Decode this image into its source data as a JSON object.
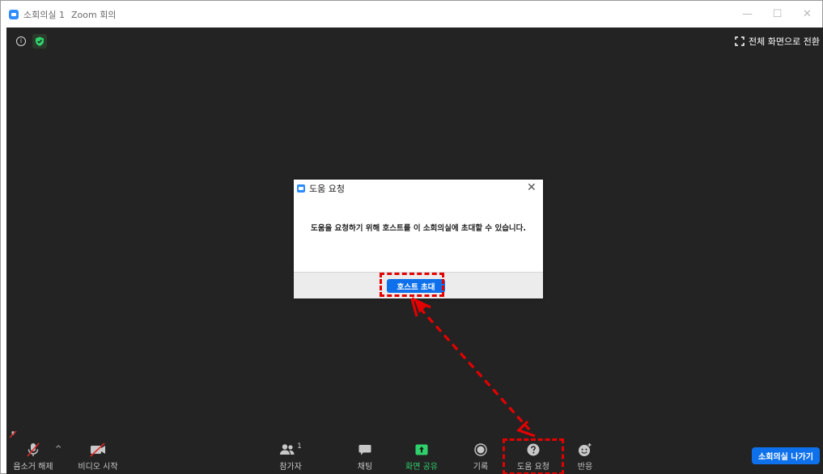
{
  "window": {
    "title": "소회의실 1",
    "subtitle": "Zoom 회의",
    "controls": {
      "minimize": "—",
      "maximize": "☐",
      "close": "✕"
    }
  },
  "meeting": {
    "info_icon": "i",
    "fullscreen_label": "전체 화면으로 전환"
  },
  "dialog": {
    "title": "도움 요청",
    "close": "✕",
    "message": "도움을 요청하기 위해 호스트를 이 소회의실에 초대할 수 있습니다.",
    "invite_button": "호스트 초대"
  },
  "toolbar": {
    "unmute": "음소거 해제",
    "start_video": "비디오 시작",
    "participants": "참가자",
    "participant_count": "1",
    "chat": "채팅",
    "share_screen": "화면 공유",
    "record": "기록",
    "ask_for_help": "도움 요청",
    "reactions": "반응",
    "leave_room": "소회의실 나가기",
    "caret": "^"
  },
  "colors": {
    "meeting_bg": "#232323",
    "zoom_blue": "#0E71EB",
    "share_green": "#2fd16b",
    "annotation_red": "#e30000"
  }
}
